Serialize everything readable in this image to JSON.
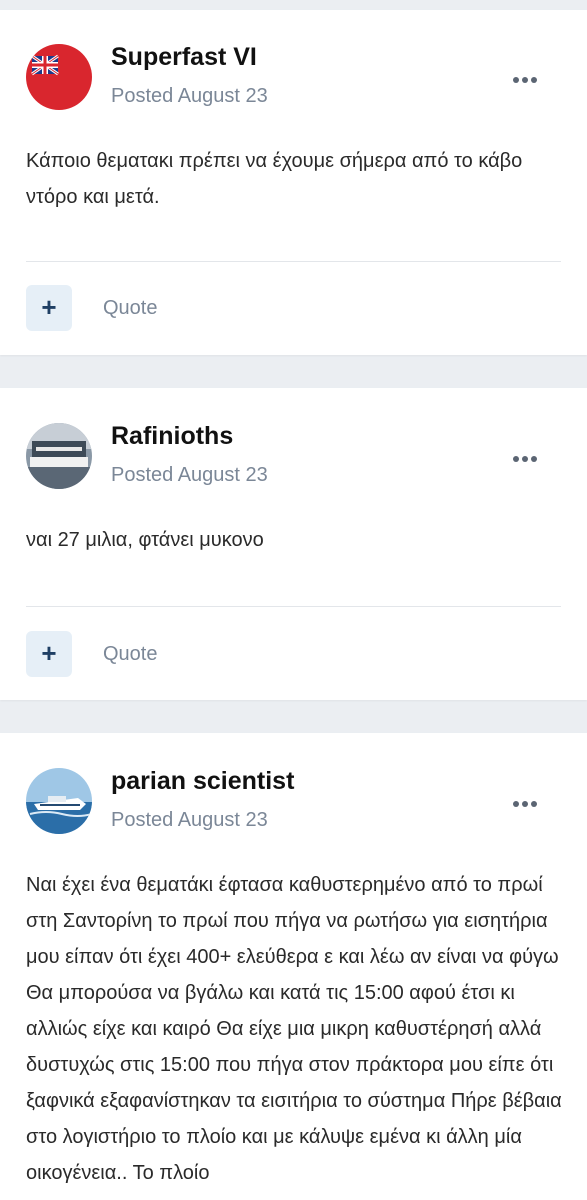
{
  "posts": [
    {
      "author": "Superfast VI",
      "posted": "Posted August 23",
      "body": "Κάποιο θεματακι πρέπει να έχουμε σήμερα από το κάβο ντόρο και μετά.",
      "plus_label": "+",
      "quote_label": "Quote"
    },
    {
      "author": "Rafinioths",
      "posted": "Posted August 23",
      "body": "ναι 27 μιλια, φτάνει μυκονο",
      "plus_label": "+",
      "quote_label": "Quote"
    },
    {
      "author": "parian scientist",
      "posted": "Posted August 23",
      "body": "Ναι έχει ένα θεματάκι έφτασα καθυστερημένο από το πρωί στη Σαντορίνη το πρωί που πήγα να ρωτήσω για εισητήρια μου είπαν ότι έχει 400+ ελεύθερα ε και λέω αν είναι να φύγω Θα μπορούσα να βγάλω και κατά τις 15:00 αφού έτσι κι αλλιώς είχε και καιρό Θα είχε μια μικρη καθυστέρησή αλλά δυστυχώς στις 15:00 που πήγα στον πράκτορα μου είπε ότι ξαφνικά εξαφανίστηκαν τα εισιτήρια το σύστημα Πήρε βέβαια στο λογιστήριο το πλοίο και με κάλυψε εμένα κι άλλη μία οικογένεια.. Το πλοίο"
    }
  ],
  "icons": {
    "more": "more-options-icon",
    "plus": "plus-icon"
  }
}
